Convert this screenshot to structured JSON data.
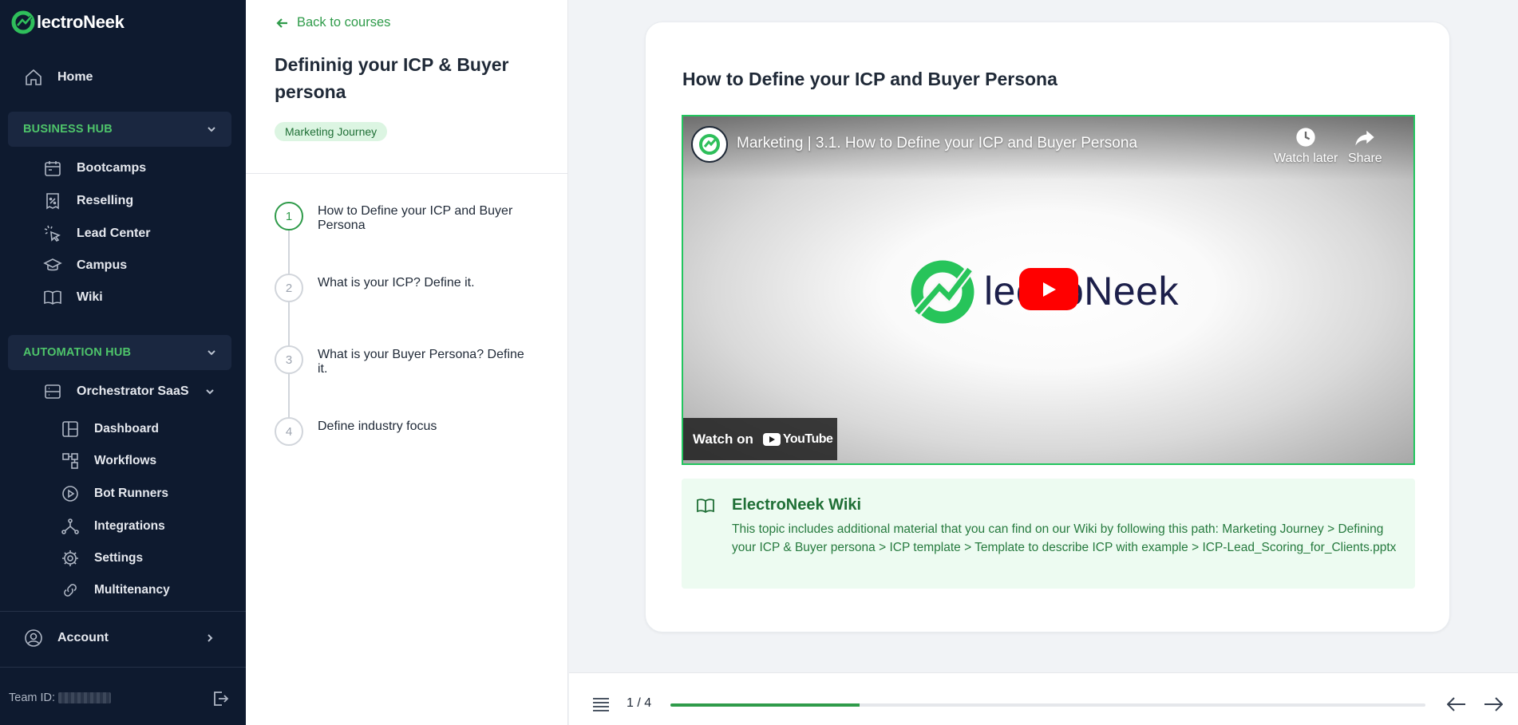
{
  "sidebar": {
    "logo_text": "lectroNeek",
    "home": "Home",
    "business_hub": "BUSINESS HUB",
    "business_items": [
      "Bootcamps",
      "Reselling",
      "Lead Center",
      "Campus",
      "Wiki"
    ],
    "automation_hub": "AUTOMATION HUB",
    "orchestrator": "Orchestrator SaaS",
    "orchestrator_items": [
      "Dashboard",
      "Workflows",
      "Bot Runners",
      "Integrations",
      "Settings",
      "Multitenancy"
    ],
    "account": "Account",
    "team_id_label": "Team ID:"
  },
  "course": {
    "back_label": "Back to courses",
    "title": "Defininig your ICP & Buyer persona",
    "tag": "Marketing Journey",
    "steps": [
      {
        "num": "1",
        "label": "How to Define your ICP and Buyer Persona"
      },
      {
        "num": "2",
        "label": "What is your ICP? Define it."
      },
      {
        "num": "3",
        "label": "What is your Buyer Persona? Define it."
      },
      {
        "num": "4",
        "label": "Define industry focus"
      }
    ]
  },
  "lesson": {
    "title": "How to Define your ICP and Buyer Persona",
    "video": {
      "title": "Marketing | 3.1. How to Define your ICP and Buyer Persona",
      "watch_later": "Watch later",
      "share": "Share",
      "brand_text": "lectroNeek",
      "watch_on": "Watch on",
      "youtube": "YouTube"
    },
    "wiki": {
      "title": "ElectroNeek Wiki",
      "text": "This topic includes additional material that you can find on our Wiki by following this path: Marketing Journey > Defining your ICP & Buyer persona > ICP template > Template to describe ICP with example > ICP-Lead_Scoring_for_Clients.pptx"
    }
  },
  "footer": {
    "counter": "1 / 4",
    "progress": 0.25
  },
  "colors": {
    "sidebar_bg": "#0e1a2f",
    "accent": "#2f9b4a",
    "hub_label": "#4ec46a"
  }
}
